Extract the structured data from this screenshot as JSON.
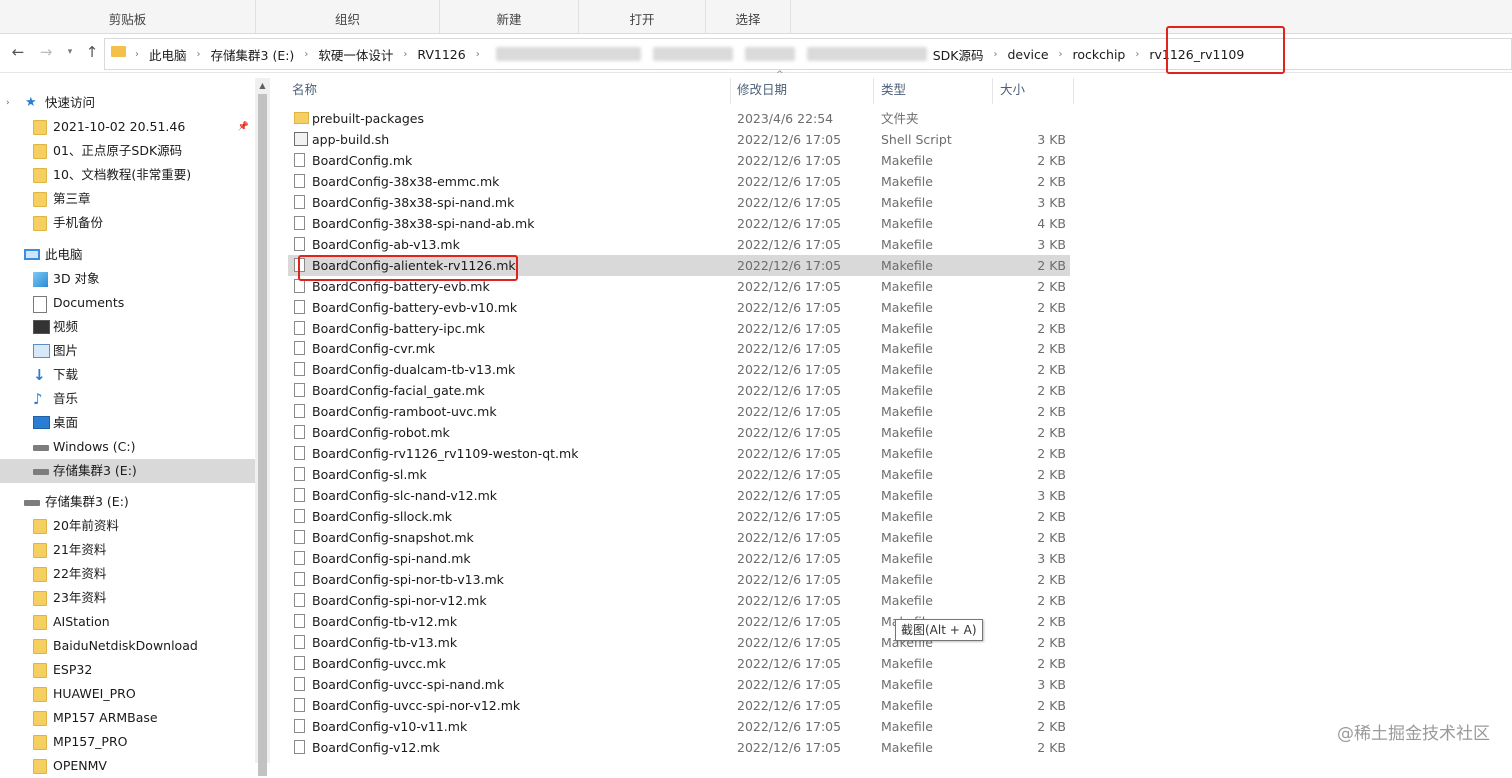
{
  "ribbon": {
    "groups": [
      "剪贴板",
      "组织",
      "新建",
      "打开",
      "选择"
    ]
  },
  "nav": {
    "back_icon": "back-arrow-icon",
    "forward_icon": "forward-arrow-icon",
    "recent_icon": "chevron-down-icon",
    "up_icon": "up-arrow-icon"
  },
  "address": {
    "crumbs": [
      "此电脑",
      "存储集群3 (E:)",
      "软硬一体设计",
      "RV1126",
      "SDK源码",
      "device",
      "rockchip",
      "rv1126_rv1109"
    ]
  },
  "sidebar": {
    "quick_access_label": "快速访问",
    "quick_access": [
      "2021-10-02 20.51.46",
      "01、正点原子SDK源码",
      "10、文档教程(非常重要)",
      "第三章",
      "手机备份"
    ],
    "this_pc_label": "此电脑",
    "this_pc": [
      "3D 对象",
      "Documents",
      "视频",
      "图片",
      "下载",
      "音乐",
      "桌面",
      "Windows (C:)",
      "存储集群3 (E:)"
    ],
    "drive_label": "存储集群3 (E:)",
    "drive_folders": [
      "20年前资料",
      "21年资料",
      "22年资料",
      "23年资料",
      "AIStation",
      "BaiduNetdiskDownload",
      "ESP32",
      "HUAWEI_PRO",
      "MP157 ARMBase",
      "MP157_PRO",
      "OPENMV"
    ]
  },
  "columns": {
    "name": "名称",
    "date": "修改日期",
    "type": "类型",
    "size": "大小"
  },
  "files": [
    {
      "name": "prebuilt-packages",
      "date": "2023/4/6 22:54",
      "type": "文件夹",
      "size": "",
      "icon": "folder"
    },
    {
      "name": "app-build.sh",
      "date": "2022/12/6 17:05",
      "type": "Shell Script",
      "size": "3 KB",
      "icon": "script"
    },
    {
      "name": "BoardConfig.mk",
      "date": "2022/12/6 17:05",
      "type": "Makefile",
      "size": "2 KB",
      "icon": "file"
    },
    {
      "name": "BoardConfig-38x38-emmc.mk",
      "date": "2022/12/6 17:05",
      "type": "Makefile",
      "size": "2 KB",
      "icon": "file"
    },
    {
      "name": "BoardConfig-38x38-spi-nand.mk",
      "date": "2022/12/6 17:05",
      "type": "Makefile",
      "size": "3 KB",
      "icon": "file"
    },
    {
      "name": "BoardConfig-38x38-spi-nand-ab.mk",
      "date": "2022/12/6 17:05",
      "type": "Makefile",
      "size": "4 KB",
      "icon": "file"
    },
    {
      "name": "BoardConfig-ab-v13.mk",
      "date": "2022/12/6 17:05",
      "type": "Makefile",
      "size": "3 KB",
      "icon": "file"
    },
    {
      "name": "BoardConfig-alientek-rv1126.mk",
      "date": "2022/12/6 17:05",
      "type": "Makefile",
      "size": "2 KB",
      "icon": "file"
    },
    {
      "name": "BoardConfig-battery-evb.mk",
      "date": "2022/12/6 17:05",
      "type": "Makefile",
      "size": "2 KB",
      "icon": "file"
    },
    {
      "name": "BoardConfig-battery-evb-v10.mk",
      "date": "2022/12/6 17:05",
      "type": "Makefile",
      "size": "2 KB",
      "icon": "file"
    },
    {
      "name": "BoardConfig-battery-ipc.mk",
      "date": "2022/12/6 17:05",
      "type": "Makefile",
      "size": "2 KB",
      "icon": "file"
    },
    {
      "name": "BoardConfig-cvr.mk",
      "date": "2022/12/6 17:05",
      "type": "Makefile",
      "size": "2 KB",
      "icon": "file"
    },
    {
      "name": "BoardConfig-dualcam-tb-v13.mk",
      "date": "2022/12/6 17:05",
      "type": "Makefile",
      "size": "2 KB",
      "icon": "file"
    },
    {
      "name": "BoardConfig-facial_gate.mk",
      "date": "2022/12/6 17:05",
      "type": "Makefile",
      "size": "2 KB",
      "icon": "file"
    },
    {
      "name": "BoardConfig-ramboot-uvc.mk",
      "date": "2022/12/6 17:05",
      "type": "Makefile",
      "size": "2 KB",
      "icon": "file"
    },
    {
      "name": "BoardConfig-robot.mk",
      "date": "2022/12/6 17:05",
      "type": "Makefile",
      "size": "2 KB",
      "icon": "file"
    },
    {
      "name": "BoardConfig-rv1126_rv1109-weston-qt.mk",
      "date": "2022/12/6 17:05",
      "type": "Makefile",
      "size": "2 KB",
      "icon": "file"
    },
    {
      "name": "BoardConfig-sl.mk",
      "date": "2022/12/6 17:05",
      "type": "Makefile",
      "size": "2 KB",
      "icon": "file"
    },
    {
      "name": "BoardConfig-slc-nand-v12.mk",
      "date": "2022/12/6 17:05",
      "type": "Makefile",
      "size": "3 KB",
      "icon": "file"
    },
    {
      "name": "BoardConfig-sllock.mk",
      "date": "2022/12/6 17:05",
      "type": "Makefile",
      "size": "2 KB",
      "icon": "file"
    },
    {
      "name": "BoardConfig-snapshot.mk",
      "date": "2022/12/6 17:05",
      "type": "Makefile",
      "size": "2 KB",
      "icon": "file"
    },
    {
      "name": "BoardConfig-spi-nand.mk",
      "date": "2022/12/6 17:05",
      "type": "Makefile",
      "size": "3 KB",
      "icon": "file"
    },
    {
      "name": "BoardConfig-spi-nor-tb-v13.mk",
      "date": "2022/12/6 17:05",
      "type": "Makefile",
      "size": "2 KB",
      "icon": "file"
    },
    {
      "name": "BoardConfig-spi-nor-v12.mk",
      "date": "2022/12/6 17:05",
      "type": "Makefile",
      "size": "2 KB",
      "icon": "file"
    },
    {
      "name": "BoardConfig-tb-v12.mk",
      "date": "2022/12/6 17:05",
      "type": "Makefile",
      "size": "2 KB",
      "icon": "file"
    },
    {
      "name": "BoardConfig-tb-v13.mk",
      "date": "2022/12/6 17:05",
      "type": "Makefile",
      "size": "2 KB",
      "icon": "file"
    },
    {
      "name": "BoardConfig-uvcc.mk",
      "date": "2022/12/6 17:05",
      "type": "Makefile",
      "size": "2 KB",
      "icon": "file"
    },
    {
      "name": "BoardConfig-uvcc-spi-nand.mk",
      "date": "2022/12/6 17:05",
      "type": "Makefile",
      "size": "3 KB",
      "icon": "file"
    },
    {
      "name": "BoardConfig-uvcc-spi-nor-v12.mk",
      "date": "2022/12/6 17:05",
      "type": "Makefile",
      "size": "2 KB",
      "icon": "file"
    },
    {
      "name": "BoardConfig-v10-v11.mk",
      "date": "2022/12/6 17:05",
      "type": "Makefile",
      "size": "2 KB",
      "icon": "file"
    },
    {
      "name": "BoardConfig-v12.mk",
      "date": "2022/12/6 17:05",
      "type": "Makefile",
      "size": "2 KB",
      "icon": "file"
    }
  ],
  "selected_file_index": 7,
  "tooltip": "截图(Alt + A)",
  "watermark": "@稀土掘金技术社区",
  "colors": {
    "highlight": "#e0241b",
    "selected_row": "#d9d9d9",
    "folder": "#f6cf63"
  }
}
